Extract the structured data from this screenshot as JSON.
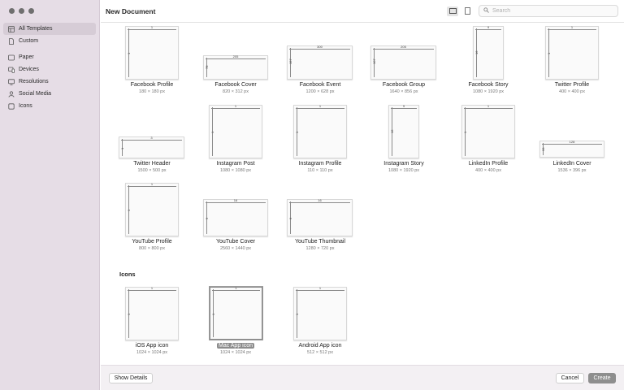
{
  "window": {
    "title": "New Document"
  },
  "sidebar": {
    "items": [
      {
        "label": "All Templates",
        "icon": "grid-icon",
        "selected": true
      },
      {
        "label": "Custom",
        "icon": "document-icon"
      },
      {
        "label": "Paper",
        "icon": "paper-icon"
      },
      {
        "label": "Devices",
        "icon": "devices-icon"
      },
      {
        "label": "Resolutions",
        "icon": "monitor-icon"
      },
      {
        "label": "Social Media",
        "icon": "person-icon"
      },
      {
        "label": "Icons",
        "icon": "square-icon"
      }
    ]
  },
  "search": {
    "placeholder": "Search",
    "value": ""
  },
  "sections": {
    "icons_title": "Icons"
  },
  "templates": [
    {
      "name": "Facebook Profile",
      "size": "180 × 180 px",
      "hdim": "1",
      "vdim": "1"
    },
    {
      "name": "Facebook Cover",
      "size": "820 × 312 px",
      "hdim": "205",
      "vdim": "78"
    },
    {
      "name": "Facebook Event",
      "size": "1200 × 628 px",
      "hdim": "300",
      "vdim": "157"
    },
    {
      "name": "Facebook Group",
      "size": "1640 × 856 px",
      "hdim": "205",
      "vdim": "107"
    },
    {
      "name": "Facebook Story",
      "size": "1080 × 1920 px",
      "hdim": "9",
      "vdim": "16"
    },
    {
      "name": "Twitter Profile",
      "size": "400 × 400 px",
      "hdim": "1",
      "vdim": "1"
    },
    {
      "name": "Twitter Header",
      "size": "1500 × 500 px",
      "hdim": "3",
      "vdim": "1"
    },
    {
      "name": "Instagram Post",
      "size": "1080 × 1080 px",
      "hdim": "1",
      "vdim": "1"
    },
    {
      "name": "Instagram Profile",
      "size": "110 × 110 px",
      "hdim": "1",
      "vdim": "1"
    },
    {
      "name": "Instagram Story",
      "size": "1080 × 1920 px",
      "hdim": "9",
      "vdim": "16"
    },
    {
      "name": "LinkedIn Profile",
      "size": "400 × 400 px",
      "hdim": "1",
      "vdim": "1"
    },
    {
      "name": "LinkedIn Cover",
      "size": "1536 × 396 px",
      "hdim": "128",
      "vdim": "33"
    },
    {
      "name": "YouTube Profile",
      "size": "800 × 800 px",
      "hdim": "1",
      "vdim": "1"
    },
    {
      "name": "YouTube Cover",
      "size": "2560 × 1440 px",
      "hdim": "16",
      "vdim": "9"
    },
    {
      "name": "YouTube Thumbnail",
      "size": "1280 × 720 px",
      "hdim": "16",
      "vdim": "9"
    }
  ],
  "icon_templates": [
    {
      "name": "iOS App icon",
      "size": "1024 × 1024 px",
      "hdim": "1",
      "vdim": "1"
    },
    {
      "name": "Mac App icon",
      "size": "1024 × 1024 px",
      "hdim": "1",
      "vdim": "1",
      "selected": true
    },
    {
      "name": "Android App icon",
      "size": "512 × 512 px",
      "hdim": "1",
      "vdim": "1"
    }
  ],
  "footer": {
    "show_details": "Show Details",
    "cancel": "Cancel",
    "create": "Create"
  },
  "colors": {
    "sidebar_bg": "#e6dde6",
    "selected_item": "#d6ccd6",
    "primary_button": "#8e8e8e"
  }
}
